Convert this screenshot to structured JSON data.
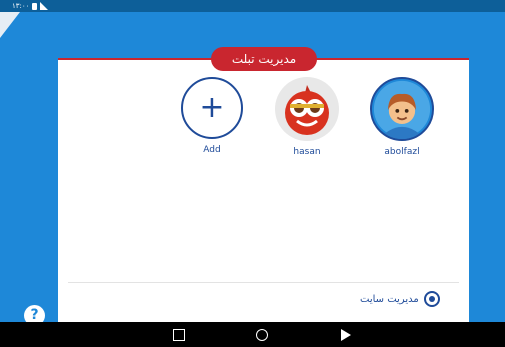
{
  "status_bar": {
    "time": "۱۳:۰۰"
  },
  "header": {
    "title": "مدیریت تبلت"
  },
  "profiles": [
    {
      "label": "abolfazl",
      "avatar": "boy-avatar"
    },
    {
      "label": "hasan",
      "avatar": "pomegranate-avatar"
    },
    {
      "label": "Add",
      "avatar": "add-icon"
    }
  ],
  "footer": {
    "manage_site_label": "مدیریت سایت"
  },
  "help": {
    "label": "?"
  },
  "colors": {
    "brand_blue": "#1e88d8",
    "accent_red": "#c9262f",
    "text_blue": "#1f4b99"
  }
}
